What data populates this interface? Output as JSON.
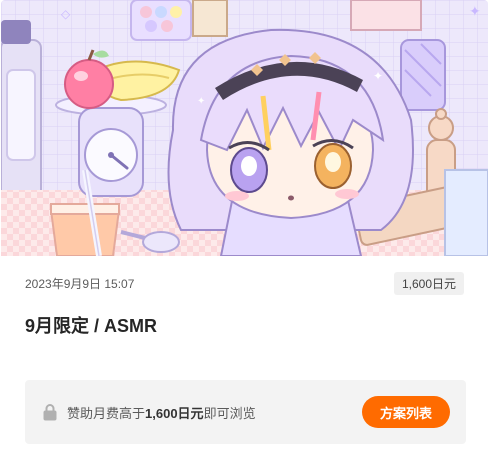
{
  "post": {
    "date": "2023年9月9日 15:07",
    "price": "1,600日元",
    "title": "9月限定 / ASMR"
  },
  "locked": {
    "prefix": "赞助月费高于",
    "amount": "1,600日元",
    "suffix": "即可浏览",
    "button_label": "方案列表",
    "button_color": "#ff6b00"
  },
  "hero_illustration": {
    "subject": "chibi anime girl with lavender hair and headband",
    "icons": [
      "apple-icon",
      "banana-icon",
      "kitchen-scale-icon",
      "juice-glass-icon",
      "pepper-mill-icon",
      "blender-icon"
    ]
  }
}
